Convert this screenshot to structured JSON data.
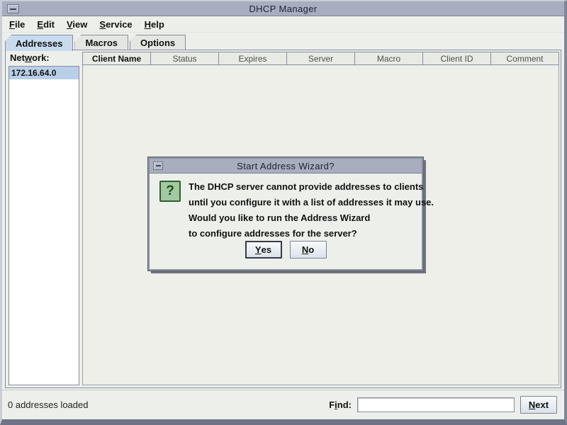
{
  "window": {
    "title": "DHCP Manager"
  },
  "menu": {
    "items": [
      {
        "pre": "",
        "mn": "F",
        "post": "ile"
      },
      {
        "pre": "",
        "mn": "E",
        "post": "dit"
      },
      {
        "pre": "",
        "mn": "V",
        "post": "iew"
      },
      {
        "pre": "",
        "mn": "S",
        "post": "ervice"
      },
      {
        "pre": "",
        "mn": "H",
        "post": "elp"
      }
    ]
  },
  "tabs": [
    {
      "label": "Addresses",
      "selected": true
    },
    {
      "label": "Macros",
      "selected": false
    },
    {
      "label": "Options",
      "selected": false
    }
  ],
  "network_panel": {
    "label": {
      "pre": "Net",
      "mn": "w",
      "post": "ork:"
    },
    "items": [
      "172.16.64.0"
    ],
    "selected_index": 0
  },
  "table": {
    "headers": [
      "Client Name",
      "Status",
      "Expires",
      "Server",
      "Macro",
      "Client ID",
      "Comment"
    ],
    "rows": []
  },
  "dialog": {
    "title": "Start Address Wizard?",
    "icon": "question-icon",
    "icon_glyph": "?",
    "message_lines": [
      "The DHCP server cannot provide addresses to clients",
      "until you configure it with a list of addresses it may use.",
      "Would you like to run the Address Wizard",
      "to configure addresses for the server?"
    ],
    "buttons": {
      "yes": {
        "pre": "",
        "mn": "Y",
        "post": "es"
      },
      "no": {
        "pre": "",
        "mn": "N",
        "post": "o"
      }
    }
  },
  "status_bar": {
    "message": "0 addresses loaded",
    "find_label": {
      "pre": "F",
      "mn": "i",
      "post": "nd:"
    },
    "find_value": "",
    "next_button": {
      "pre": "",
      "mn": "N",
      "post": "ext"
    }
  },
  "colors": {
    "titlebar": "#a8aebe",
    "tab_selected": "#c8daee",
    "list_selection": "#b9cfe8",
    "question_icon_green": "#a2c9a2",
    "question_icon_border": "#2d5f2d",
    "content_bg": "#edf0ea"
  }
}
